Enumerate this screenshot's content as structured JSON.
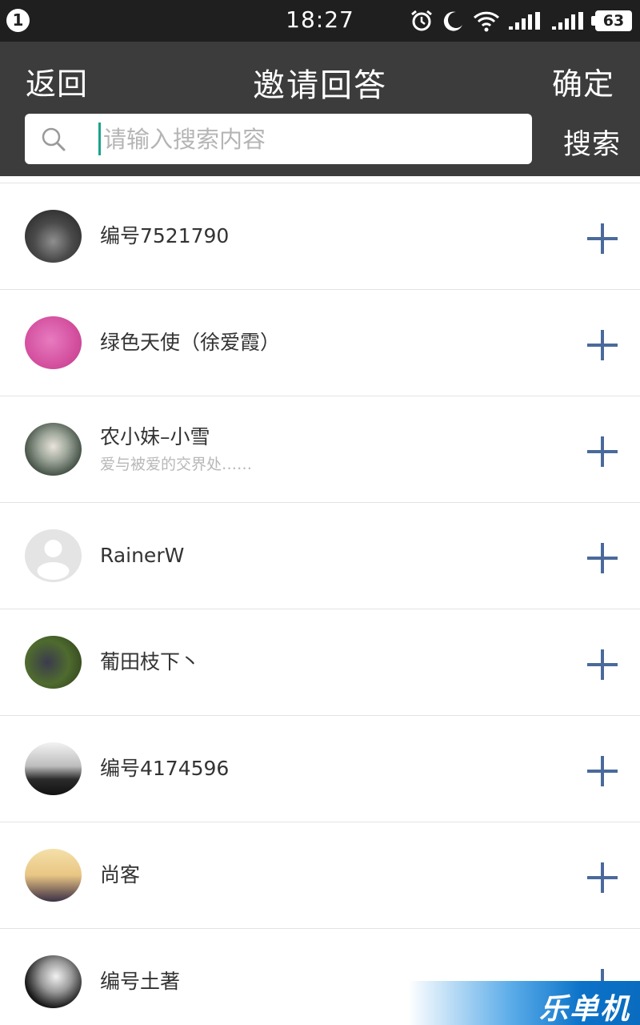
{
  "status_bar": {
    "notification_count": "1",
    "time": "18:27",
    "icons": [
      "alarm-icon",
      "moon-icon",
      "wifi-icon",
      "signal-1-icon",
      "signal-2-icon"
    ],
    "battery": "63"
  },
  "header": {
    "back_label": "返回",
    "title": "邀请回答",
    "confirm_label": "确定",
    "search_placeholder": "请输入搜索内容",
    "search_value": "",
    "search_button_label": "搜索"
  },
  "list": {
    "items": [
      {
        "name": "编号7521790",
        "subtitle": ""
      },
      {
        "name": "绿色天使（徐爱霞）",
        "subtitle": ""
      },
      {
        "name": "农小妹–小雪",
        "subtitle": "爱与被爱的交界处……"
      },
      {
        "name": "RainerW",
        "subtitle": ""
      },
      {
        "name": "葡田枝下丶",
        "subtitle": ""
      },
      {
        "name": "编号4174596",
        "subtitle": ""
      },
      {
        "name": "尚客",
        "subtitle": ""
      },
      {
        "name": "编号土著",
        "subtitle": ""
      }
    ]
  },
  "watermark": {
    "text": "乐单机"
  },
  "colors": {
    "header_bg": "#3c3c3c",
    "status_bar_bg": "#1f1f1f",
    "add_icon": "#4a6a9b",
    "cursor": "#1aa38a",
    "divider": "#e3e3e3"
  }
}
